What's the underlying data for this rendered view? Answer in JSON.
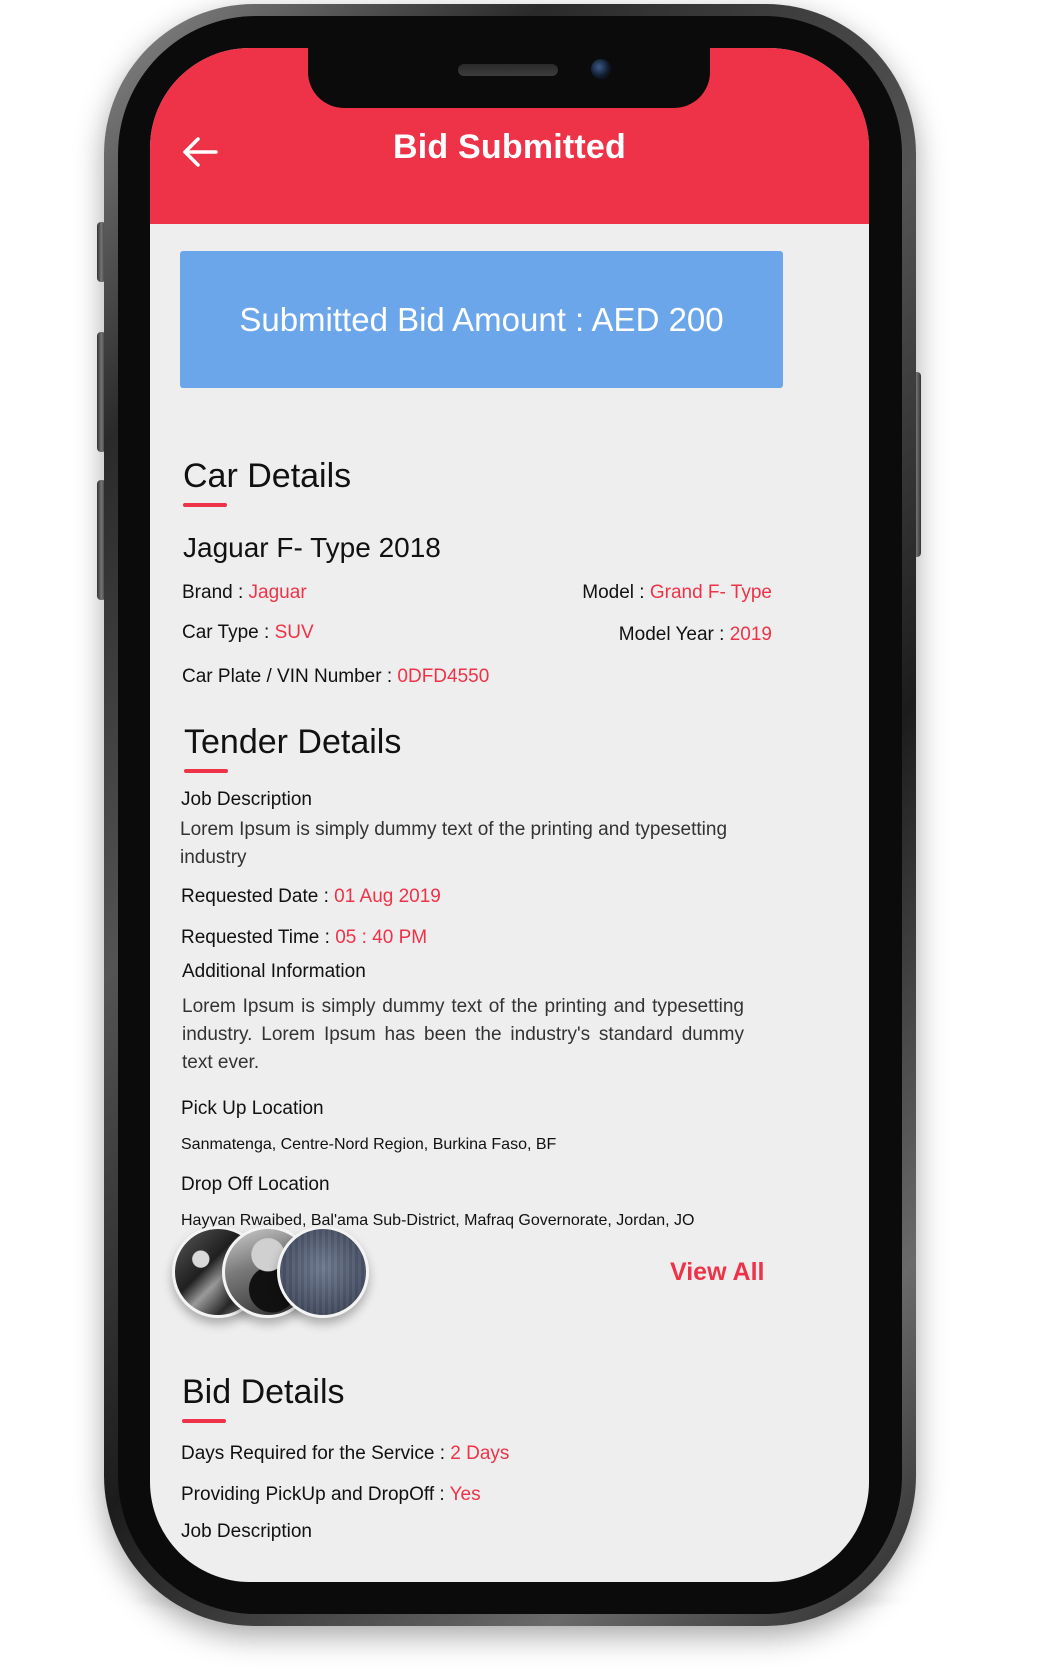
{
  "header": {
    "title": "Bid Submitted",
    "back_icon": "arrow-left-icon"
  },
  "banner": {
    "text": "Submitted Bid Amount : AED 200"
  },
  "car_details": {
    "section_title": "Car Details",
    "car_name": "Jaguar F- Type 2018",
    "brand_label": "Brand : ",
    "brand_value": "Jaguar",
    "model_label": "Model : ",
    "model_value": "Grand F- Type",
    "car_type_label": "Car Type : ",
    "car_type_value": "SUV",
    "model_year_label": "Model Year : ",
    "model_year_value": "2019",
    "plate_label": "Car Plate / VIN Number : ",
    "plate_value": "0DFD4550"
  },
  "tender_details": {
    "section_title": "Tender Details",
    "job_description_label": "Job Description",
    "job_description_text": "Lorem Ipsum is simply dummy text of the printing and typesetting industry",
    "requested_date_label": "Requested Date : ",
    "requested_date_value": "01 Aug 2019",
    "requested_time_label": "Requested Time  : ",
    "requested_time_value": "05 : 40 PM",
    "additional_info_label": "Additional Information",
    "additional_info_text": "Lorem Ipsum is simply dummy text of the printing and typesetting industry. Lorem Ipsum has been the industry's standard dummy text ever.",
    "pickup_label": "Pick Up Location",
    "pickup_value": "Sanmatenga, Centre-Nord Region, Burkina Faso, BF",
    "dropoff_label": "Drop Off Location",
    "dropoff_value": "Hayyan Rwaibed, Bal'ama Sub-District, Mafraq Governorate, Jordan, JO",
    "view_all_label": "View All"
  },
  "bid_details": {
    "section_title": "Bid Details",
    "days_label": "Days Required for the Service : ",
    "days_value": "2 Days",
    "pickup_dropoff_label": "Providing PickUp and DropOff : ",
    "pickup_dropoff_value": "Yes",
    "job_description_label": "Job Description"
  },
  "colors": {
    "accent": "#ee3348",
    "banner": "#6ca6ea",
    "background": "#eeeeee"
  }
}
